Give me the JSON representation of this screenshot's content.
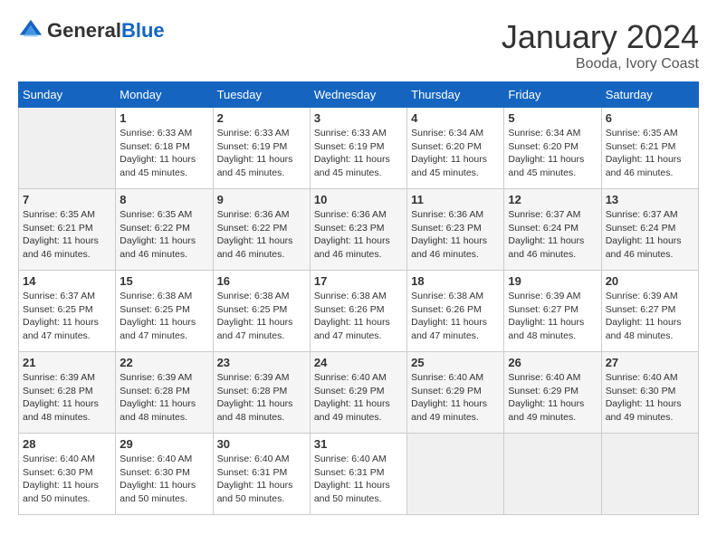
{
  "header": {
    "logo_general": "General",
    "logo_blue": "Blue",
    "title": "January 2024",
    "subtitle": "Booda, Ivory Coast"
  },
  "days_of_week": [
    "Sunday",
    "Monday",
    "Tuesday",
    "Wednesday",
    "Thursday",
    "Friday",
    "Saturday"
  ],
  "weeks": [
    [
      {
        "day": "",
        "empty": true
      },
      {
        "day": "1",
        "sunrise": "Sunrise: 6:33 AM",
        "sunset": "Sunset: 6:18 PM",
        "daylight": "Daylight: 11 hours and 45 minutes."
      },
      {
        "day": "2",
        "sunrise": "Sunrise: 6:33 AM",
        "sunset": "Sunset: 6:19 PM",
        "daylight": "Daylight: 11 hours and 45 minutes."
      },
      {
        "day": "3",
        "sunrise": "Sunrise: 6:33 AM",
        "sunset": "Sunset: 6:19 PM",
        "daylight": "Daylight: 11 hours and 45 minutes."
      },
      {
        "day": "4",
        "sunrise": "Sunrise: 6:34 AM",
        "sunset": "Sunset: 6:20 PM",
        "daylight": "Daylight: 11 hours and 45 minutes."
      },
      {
        "day": "5",
        "sunrise": "Sunrise: 6:34 AM",
        "sunset": "Sunset: 6:20 PM",
        "daylight": "Daylight: 11 hours and 45 minutes."
      },
      {
        "day": "6",
        "sunrise": "Sunrise: 6:35 AM",
        "sunset": "Sunset: 6:21 PM",
        "daylight": "Daylight: 11 hours and 46 minutes."
      }
    ],
    [
      {
        "day": "7",
        "sunrise": "Sunrise: 6:35 AM",
        "sunset": "Sunset: 6:21 PM",
        "daylight": "Daylight: 11 hours and 46 minutes."
      },
      {
        "day": "8",
        "sunrise": "Sunrise: 6:35 AM",
        "sunset": "Sunset: 6:22 PM",
        "daylight": "Daylight: 11 hours and 46 minutes."
      },
      {
        "day": "9",
        "sunrise": "Sunrise: 6:36 AM",
        "sunset": "Sunset: 6:22 PM",
        "daylight": "Daylight: 11 hours and 46 minutes."
      },
      {
        "day": "10",
        "sunrise": "Sunrise: 6:36 AM",
        "sunset": "Sunset: 6:23 PM",
        "daylight": "Daylight: 11 hours and 46 minutes."
      },
      {
        "day": "11",
        "sunrise": "Sunrise: 6:36 AM",
        "sunset": "Sunset: 6:23 PM",
        "daylight": "Daylight: 11 hours and 46 minutes."
      },
      {
        "day": "12",
        "sunrise": "Sunrise: 6:37 AM",
        "sunset": "Sunset: 6:24 PM",
        "daylight": "Daylight: 11 hours and 46 minutes."
      },
      {
        "day": "13",
        "sunrise": "Sunrise: 6:37 AM",
        "sunset": "Sunset: 6:24 PM",
        "daylight": "Daylight: 11 hours and 46 minutes."
      }
    ],
    [
      {
        "day": "14",
        "sunrise": "Sunrise: 6:37 AM",
        "sunset": "Sunset: 6:25 PM",
        "daylight": "Daylight: 11 hours and 47 minutes."
      },
      {
        "day": "15",
        "sunrise": "Sunrise: 6:38 AM",
        "sunset": "Sunset: 6:25 PM",
        "daylight": "Daylight: 11 hours and 47 minutes."
      },
      {
        "day": "16",
        "sunrise": "Sunrise: 6:38 AM",
        "sunset": "Sunset: 6:25 PM",
        "daylight": "Daylight: 11 hours and 47 minutes."
      },
      {
        "day": "17",
        "sunrise": "Sunrise: 6:38 AM",
        "sunset": "Sunset: 6:26 PM",
        "daylight": "Daylight: 11 hours and 47 minutes."
      },
      {
        "day": "18",
        "sunrise": "Sunrise: 6:38 AM",
        "sunset": "Sunset: 6:26 PM",
        "daylight": "Daylight: 11 hours and 47 minutes."
      },
      {
        "day": "19",
        "sunrise": "Sunrise: 6:39 AM",
        "sunset": "Sunset: 6:27 PM",
        "daylight": "Daylight: 11 hours and 48 minutes."
      },
      {
        "day": "20",
        "sunrise": "Sunrise: 6:39 AM",
        "sunset": "Sunset: 6:27 PM",
        "daylight": "Daylight: 11 hours and 48 minutes."
      }
    ],
    [
      {
        "day": "21",
        "sunrise": "Sunrise: 6:39 AM",
        "sunset": "Sunset: 6:28 PM",
        "daylight": "Daylight: 11 hours and 48 minutes."
      },
      {
        "day": "22",
        "sunrise": "Sunrise: 6:39 AM",
        "sunset": "Sunset: 6:28 PM",
        "daylight": "Daylight: 11 hours and 48 minutes."
      },
      {
        "day": "23",
        "sunrise": "Sunrise: 6:39 AM",
        "sunset": "Sunset: 6:28 PM",
        "daylight": "Daylight: 11 hours and 48 minutes."
      },
      {
        "day": "24",
        "sunrise": "Sunrise: 6:40 AM",
        "sunset": "Sunset: 6:29 PM",
        "daylight": "Daylight: 11 hours and 49 minutes."
      },
      {
        "day": "25",
        "sunrise": "Sunrise: 6:40 AM",
        "sunset": "Sunset: 6:29 PM",
        "daylight": "Daylight: 11 hours and 49 minutes."
      },
      {
        "day": "26",
        "sunrise": "Sunrise: 6:40 AM",
        "sunset": "Sunset: 6:29 PM",
        "daylight": "Daylight: 11 hours and 49 minutes."
      },
      {
        "day": "27",
        "sunrise": "Sunrise: 6:40 AM",
        "sunset": "Sunset: 6:30 PM",
        "daylight": "Daylight: 11 hours and 49 minutes."
      }
    ],
    [
      {
        "day": "28",
        "sunrise": "Sunrise: 6:40 AM",
        "sunset": "Sunset: 6:30 PM",
        "daylight": "Daylight: 11 hours and 50 minutes."
      },
      {
        "day": "29",
        "sunrise": "Sunrise: 6:40 AM",
        "sunset": "Sunset: 6:30 PM",
        "daylight": "Daylight: 11 hours and 50 minutes."
      },
      {
        "day": "30",
        "sunrise": "Sunrise: 6:40 AM",
        "sunset": "Sunset: 6:31 PM",
        "daylight": "Daylight: 11 hours and 50 minutes."
      },
      {
        "day": "31",
        "sunrise": "Sunrise: 6:40 AM",
        "sunset": "Sunset: 6:31 PM",
        "daylight": "Daylight: 11 hours and 50 minutes."
      },
      {
        "day": "",
        "empty": true
      },
      {
        "day": "",
        "empty": true
      },
      {
        "day": "",
        "empty": true
      }
    ]
  ]
}
